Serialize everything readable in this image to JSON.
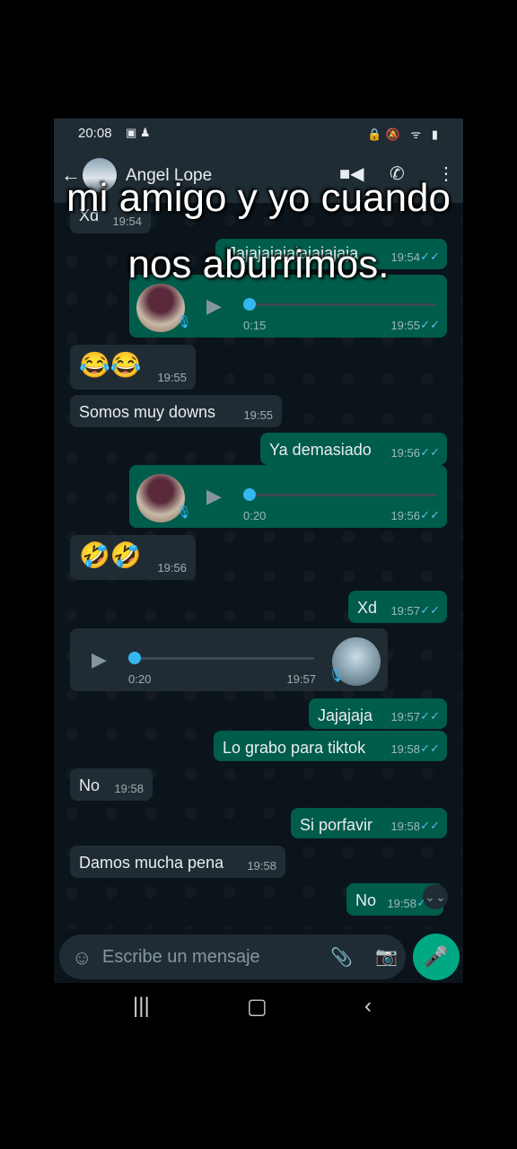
{
  "status": {
    "time": "20:08"
  },
  "contact": {
    "name": "Angel Lope"
  },
  "caption": {
    "line1": "mi amigo y yo cuando",
    "line2": "nos aburrimos."
  },
  "messages": [
    {
      "text": "Xd",
      "time": "19:54"
    },
    {
      "text": "Jajajajajajajajajaja",
      "time": "19:54"
    },
    {
      "duration": "0:15",
      "time": "19:55"
    },
    {
      "text": "😂😂",
      "time": "19:55"
    },
    {
      "text": "Somos muy downs",
      "time": "19:55"
    },
    {
      "text": "Ya demasiado",
      "time": "19:56"
    },
    {
      "duration": "0:20",
      "time": "19:56"
    },
    {
      "text": "🤣🤣",
      "time": "19:56"
    },
    {
      "text": "Xd",
      "time": "19:57"
    },
    {
      "duration": "0:20",
      "time": "19:57"
    },
    {
      "text": "Jajajaja",
      "time": "19:57"
    },
    {
      "text": "Lo grabo para tiktok",
      "time": "19:58"
    },
    {
      "text": "No",
      "time": "19:58"
    },
    {
      "text": "Si porfavir",
      "time": "19:58"
    },
    {
      "text": "Damos mucha pena",
      "time": "19:58"
    },
    {
      "text": "No",
      "time": "19:58"
    }
  ],
  "composer": {
    "placeholder": "Escribe un mensaje"
  }
}
